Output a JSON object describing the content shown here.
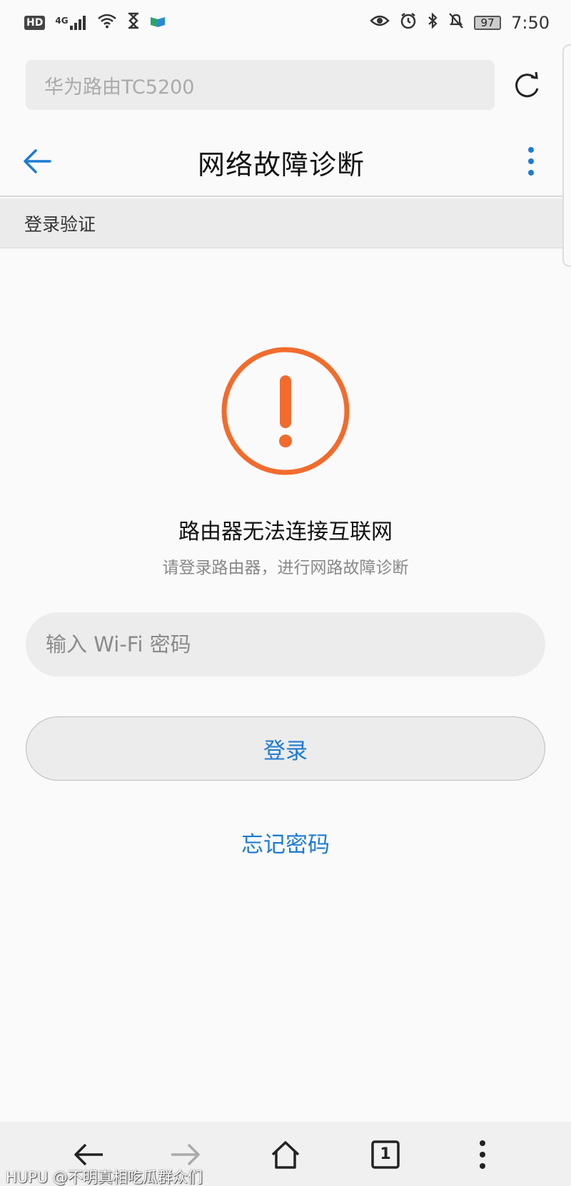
{
  "status_bar": {
    "left_badge": "HD",
    "signal_label": "4G",
    "battery": "97",
    "time": "7:50"
  },
  "address_bar": {
    "placeholder": "华为路由TC5200"
  },
  "header": {
    "title": "网络故障诊断",
    "section": "登录验证"
  },
  "main": {
    "headline": "路由器无法连接互联网",
    "subline": "请登录路由器，进行网路故障诊断",
    "password_placeholder": "输入 Wi-Fi 密码",
    "login_label": "登录",
    "forgot_label": "忘记密码"
  },
  "toolbar": {
    "tab_count": "1"
  },
  "watermark": "HUPU @不明真相吃瓜群众们",
  "colors": {
    "accent": "#1e7bd4",
    "warning": "#f26b2d"
  }
}
